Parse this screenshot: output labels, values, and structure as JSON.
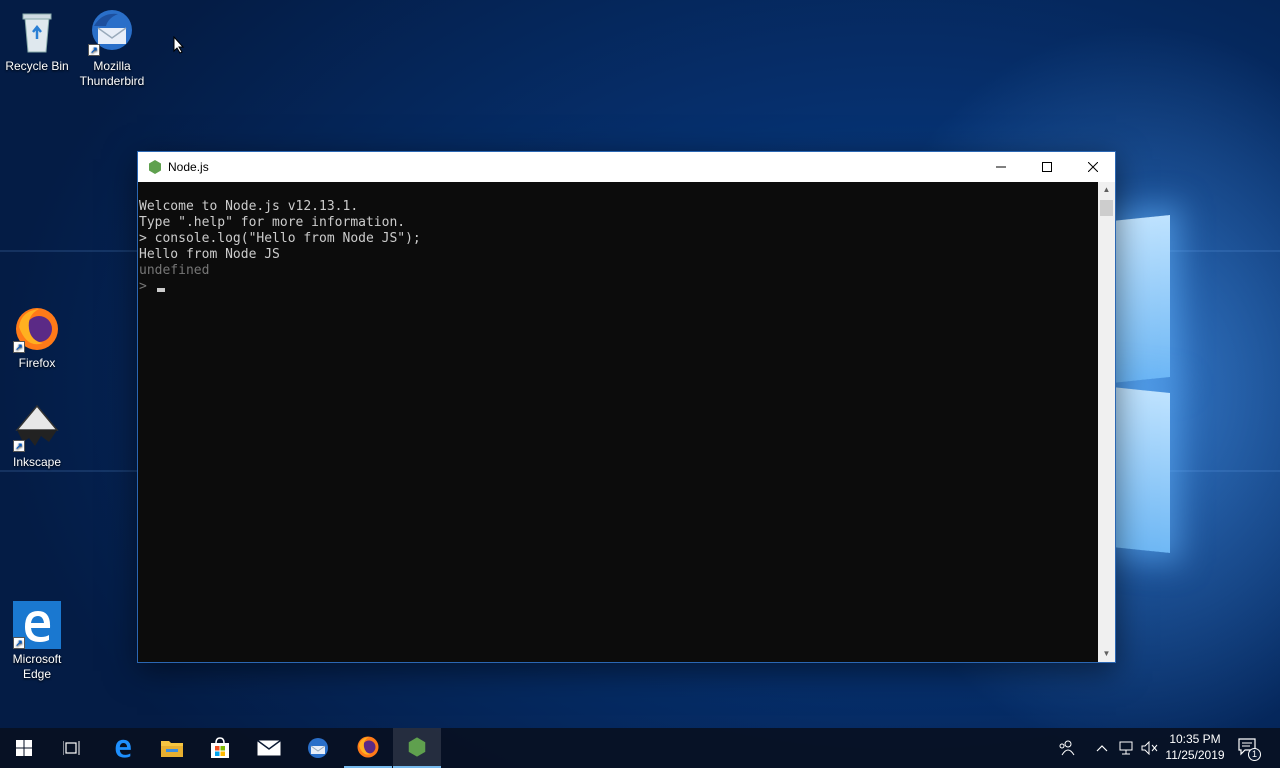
{
  "desktop": {
    "icons": [
      {
        "label_line1": "Recycle Bin",
        "label_line2": ""
      },
      {
        "label_line1": "Mozilla",
        "label_line2": "Thunderbird"
      },
      {
        "label_line1": "Firefox",
        "label_line2": ""
      },
      {
        "label_line1": "Inkscape",
        "label_line2": ""
      },
      {
        "label_line1": "Microsoft",
        "label_line2": "Edge"
      }
    ]
  },
  "window": {
    "title": "Node.js",
    "minimize_glyph": "—",
    "maximize_glyph": "☐",
    "close_glyph": "✕"
  },
  "console": {
    "lines": [
      "Welcome to Node.js v12.13.1.",
      "Type \".help\" for more information.",
      "> console.log(\"Hello from Node JS\");",
      "Hello from Node JS"
    ],
    "dim_line": "undefined",
    "prompt": "> "
  },
  "taskbar": {
    "apps": [
      "start-icon",
      "task-view-icon",
      "edge-icon",
      "file-explorer-icon",
      "store-icon",
      "mail-icon",
      "thunderbird-icon",
      "firefox-icon",
      "nodejs-icon"
    ],
    "time": "10:35 PM",
    "date": "11/25/2019",
    "notification_count": "1"
  },
  "colors": {
    "console_bg": "#0c0c0c",
    "console_fg": "#cccccc",
    "node_green": "#5fa04e",
    "taskbar_accent": "#76b9ed"
  }
}
